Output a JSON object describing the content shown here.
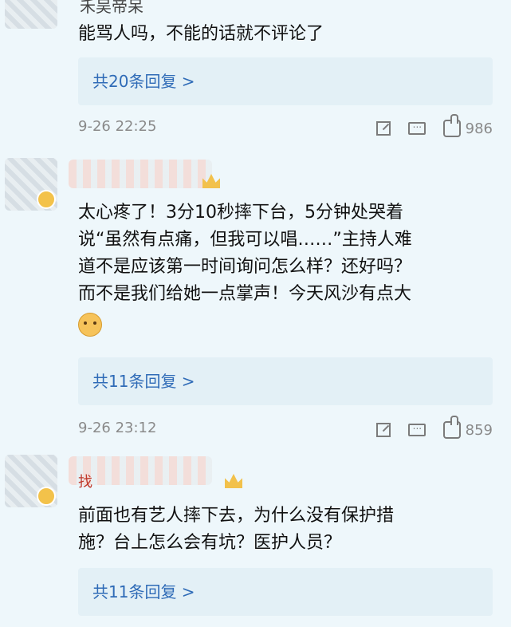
{
  "top_snippet": {
    "partial_username": "禾吴帝呆"
  },
  "comments": [
    {
      "text_lines": [
        "能骂人吗，不能的话就不评论了"
      ],
      "replies_label": "共20条回复 >",
      "time": "9-26 22:25",
      "likes": "986"
    },
    {
      "text_lines": [
        "太心疼了！3分10秒摔下台，5分钟处哭着",
        "说“虽然有点痛，但我可以唱……”主持人难",
        "道不是应该第一时间询问怎么样？还好吗？",
        "而不是我们给她一点掌声！今天风沙有点大"
      ],
      "emoji": "upside-down-face-emoji",
      "replies_label": "共11条回复 >",
      "time": "9-26 23:12",
      "likes": "859"
    },
    {
      "partial_username": "找",
      "text_lines": [
        "前面也有艺人摔下去，为什么没有保护措",
        "施？台上怎么会有坑？医护人员？"
      ],
      "replies_label": "共11条回复 >"
    }
  ],
  "colors": {
    "background": "#eef7fb",
    "reply_box": "#e3f0f6",
    "link": "#2f6bb7",
    "meta": "#8a8a8a"
  }
}
